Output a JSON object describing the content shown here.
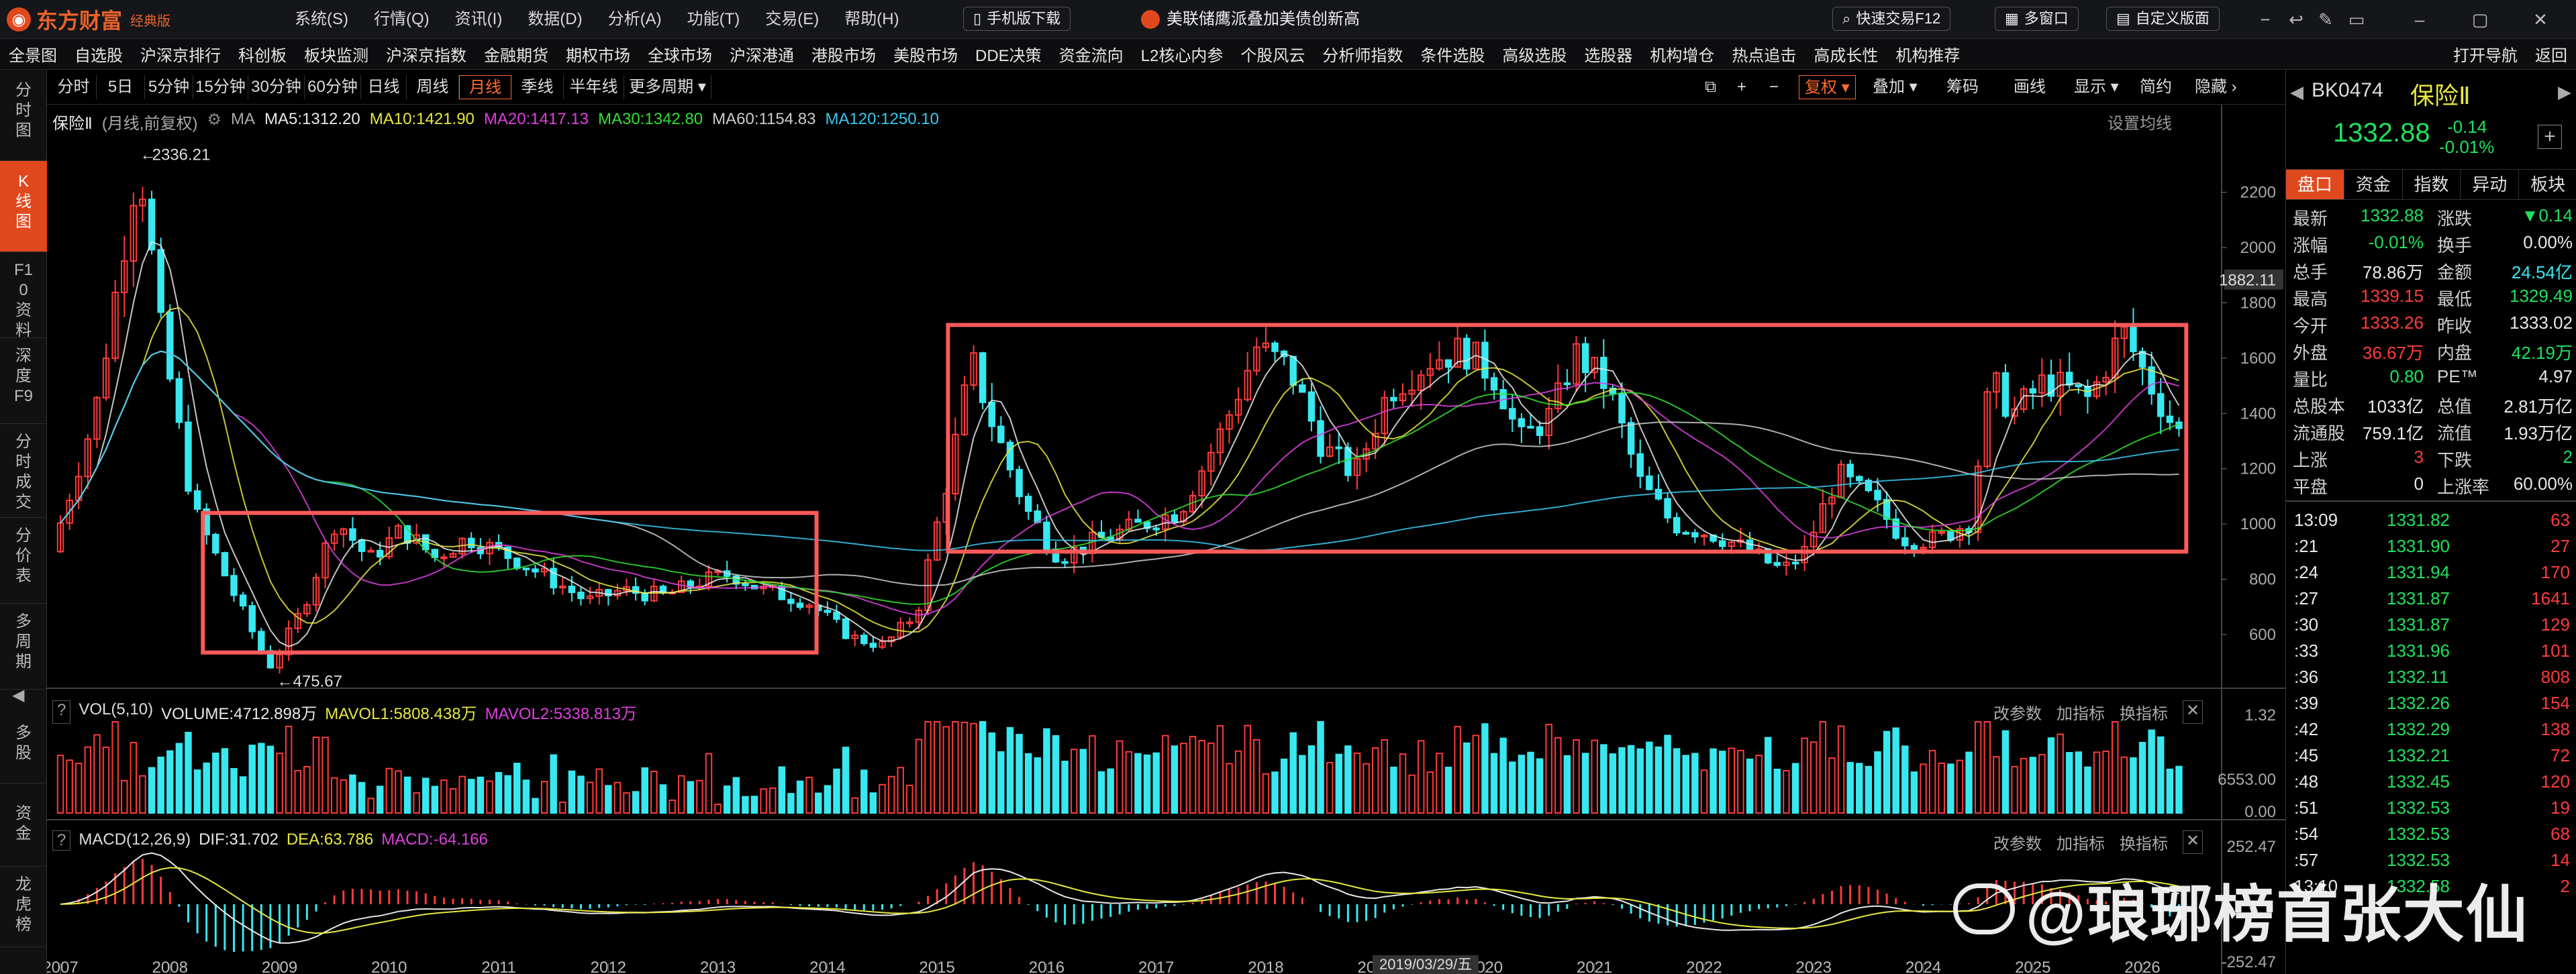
{
  "app": {
    "brand": "东方财富",
    "edition": "经典版",
    "menu": [
      "系统(S)",
      "行情(Q)",
      "资讯(I)",
      "数据(D)",
      "分析(A)",
      "功能(T)",
      "交易(E)",
      "帮助(H)"
    ],
    "mobile_download": "手机版下载",
    "news": "美联储鹰派叠加美债创新高",
    "quick_trade": "快速交易F12",
    "multi_window": "多窗口",
    "custom_layout": "自定义版面"
  },
  "navbar": [
    "全景图",
    "自选股",
    "沪深京排行",
    "科创板",
    "板块监测",
    "沪深京指数",
    "金融期货",
    "期权市场",
    "全球市场",
    "沪深港通",
    "港股市场",
    "美股市场",
    "DDE决策",
    "资金流向",
    "L2核心内参",
    "个股风云",
    "分析师指数",
    "条件选股",
    "高级选股",
    "选股器",
    "机构增仓",
    "热点追击",
    "高成长性",
    "机构推荐",
    "打开导航",
    "返回"
  ],
  "leftbar": [
    "分时图",
    "K线图",
    "F10资料",
    "深度F9",
    "分时成交",
    "分价表",
    "多周期",
    "多股",
    "资金",
    "龙虎榜"
  ],
  "toolbar": {
    "periods": [
      "分时",
      "5日",
      "5分钟",
      "15分钟",
      "30分钟",
      "60分钟",
      "日线",
      "周线",
      "月线",
      "季线",
      "半年线",
      "更多周期"
    ],
    "active_period": "月线",
    "right": [
      "复权",
      "叠加",
      "筹码",
      "画线",
      "显示",
      "简约",
      "隐藏"
    ]
  },
  "chart_legend": {
    "name": "保险Ⅱ",
    "mode": "(月线,前复权)",
    "ma_label": "MA",
    "ma5": "MA5:1312.20",
    "ma10": "MA10:1421.90",
    "ma20": "MA20:1417.13",
    "ma30": "MA30:1342.80",
    "ma60": "MA60:1154.83",
    "ma120": "MA120:1250.10",
    "set_ma": "设置均线"
  },
  "volume_legend": {
    "label": "VOL(5,10)",
    "volume": "VOLUME:4712.898万",
    "mavol1": "MAVOL1:5808.438万",
    "mavol2": "MAVOL2:5338.813万",
    "actions": [
      "改参数",
      "加指标",
      "换指标"
    ]
  },
  "macd_legend": {
    "label": "MACD(12,26,9)",
    "dif": "DIF:31.702",
    "dea": "DEA:63.786",
    "macd": "MACD:-64.166",
    "actions": [
      "改参数",
      "加指标",
      "换指标"
    ]
  },
  "cursor_date": "2019/03/29/五",
  "chart_data": {
    "type": "candlestick",
    "title": "保险Ⅱ (月线,前复权)",
    "price_axis": {
      "ticks": [
        600,
        800,
        1000,
        1200,
        1400,
        1600,
        1800,
        2000,
        2200
      ],
      "current_label": "1882.11",
      "ylim": [
        430,
        2420
      ]
    },
    "volume_axis": {
      "ticks": [
        "1.32",
        "6553.00",
        "0.00"
      ]
    },
    "macd_axis": {
      "ticks": [
        "252.47",
        "-252.47"
      ]
    },
    "x_axis_years": [
      "2007",
      "2008",
      "2009",
      "2010",
      "2011",
      "2012",
      "2013",
      "2014",
      "2015",
      "2016",
      "2017",
      "2018",
      "2019",
      "2020",
      "2021",
      "2022",
      "2023",
      "2024",
      "2025",
      "2026"
    ],
    "annotations": {
      "high_label": "2336.21",
      "low_label": "475.67"
    },
    "price_path": [
      [
        2007.0,
        900
      ],
      [
        2007.4,
        1400
      ],
      [
        2007.8,
        2336
      ],
      [
        2008.0,
        1700
      ],
      [
        2008.3,
        1050
      ],
      [
        2008.7,
        720
      ],
      [
        2009.0,
        475
      ],
      [
        2009.3,
        700
      ],
      [
        2009.6,
        1020
      ],
      [
        2009.9,
        870
      ],
      [
        2010.2,
        980
      ],
      [
        2010.5,
        880
      ],
      [
        2010.8,
        950
      ],
      [
        2011.2,
        880
      ],
      [
        2011.6,
        790
      ],
      [
        2011.9,
        720
      ],
      [
        2012.2,
        760
      ],
      [
        2012.6,
        740
      ],
      [
        2012.9,
        790
      ],
      [
        2013.2,
        820
      ],
      [
        2013.5,
        760
      ],
      [
        2013.9,
        720
      ],
      [
        2014.3,
        590
      ],
      [
        2014.6,
        560
      ],
      [
        2014.9,
        680
      ],
      [
        2015.2,
        1200
      ],
      [
        2015.4,
        1590
      ],
      [
        2015.6,
        1350
      ],
      [
        2015.9,
        1050
      ],
      [
        2016.2,
        880
      ],
      [
        2016.6,
        950
      ],
      [
        2016.9,
        990
      ],
      [
        2017.3,
        1050
      ],
      [
        2017.7,
        1350
      ],
      [
        2018.0,
        1640
      ],
      [
        2018.3,
        1560
      ],
      [
        2018.6,
        1280
      ],
      [
        2018.9,
        1180
      ],
      [
        2019.2,
        1480
      ],
      [
        2019.6,
        1600
      ],
      [
        2019.9,
        1630
      ],
      [
        2020.2,
        1520
      ],
      [
        2020.4,
        1300
      ],
      [
        2020.7,
        1400
      ],
      [
        2020.9,
        1620
      ],
      [
        2021.2,
        1500
      ],
      [
        2021.5,
        1150
      ],
      [
        2021.8,
        1000
      ],
      [
        2022.2,
        960
      ],
      [
        2022.5,
        900
      ],
      [
        2022.8,
        830
      ],
      [
        2023.0,
        900
      ],
      [
        2023.3,
        1180
      ],
      [
        2023.6,
        1090
      ],
      [
        2023.9,
        950
      ],
      [
        2024.2,
        940
      ],
      [
        2024.5,
        1010
      ],
      [
        2024.7,
        1520
      ],
      [
        2024.9,
        1400
      ],
      [
        2025.2,
        1520
      ],
      [
        2025.6,
        1450
      ],
      [
        2025.9,
        1700
      ],
      [
        2026.2,
        1470
      ],
      [
        2026.4,
        1333
      ]
    ],
    "boxes": [
      {
        "x0": 2008.3,
        "x1": 2013.9,
        "y0": 535,
        "y1": 1040
      },
      {
        "x0": 2015.1,
        "x1": 2026.4,
        "y0": 900,
        "y1": 1720
      }
    ]
  },
  "quote": {
    "code": "BK0474",
    "name": "保险Ⅱ",
    "price": "1332.88",
    "change": "-0.14",
    "change_pct": "-0.01%",
    "tabs": [
      "盘口",
      "资金",
      "指数",
      "异动",
      "板块"
    ],
    "rows": [
      {
        "l1": "最新",
        "v1": "1332.88",
        "c1": "green",
        "l2": "涨跌",
        "v2": "▼0.14",
        "c2": "green"
      },
      {
        "l1": "涨幅",
        "v1": "-0.01%",
        "c1": "green",
        "l2": "换手",
        "v2": "0.00%",
        "c2": "white"
      },
      {
        "l1": "总手",
        "v1": "78.86万",
        "c1": "white",
        "l2": "金额",
        "v2": "24.54亿",
        "c2": "cyan"
      },
      {
        "l1": "最高",
        "v1": "1339.15",
        "c1": "red",
        "l2": "最低",
        "v2": "1329.49",
        "c2": "green"
      },
      {
        "l1": "今开",
        "v1": "1333.26",
        "c1": "red",
        "l2": "昨收",
        "v2": "1333.02",
        "c2": "white"
      },
      {
        "l1": "外盘",
        "v1": "36.67万",
        "c1": "red",
        "l2": "内盘",
        "v2": "42.19万",
        "c2": "green"
      },
      {
        "l1": "量比",
        "v1": "0.80",
        "c1": "green",
        "l2": "PE™",
        "v2": "4.97",
        "c2": "white"
      },
      {
        "l1": "总股本",
        "v1": "1033亿",
        "c1": "white",
        "l2": "总值",
        "v2": "2.81万亿",
        "c2": "white"
      },
      {
        "l1": "流通股",
        "v1": "759.1亿",
        "c1": "white",
        "l2": "流值",
        "v2": "1.93万亿",
        "c2": "white"
      },
      {
        "l1": "上涨",
        "v1": "3",
        "c1": "red",
        "l2": "下跌",
        "v2": "2",
        "c2": "green"
      },
      {
        "l1": "平盘",
        "v1": "0",
        "c1": "white",
        "l2": "上涨率",
        "v2": "60.00%",
        "c2": "white"
      }
    ],
    "ticks": [
      {
        "t": "13:09",
        "p": "1331.82",
        "v": "63"
      },
      {
        "t": ":21",
        "p": "1331.90",
        "v": "27"
      },
      {
        "t": ":24",
        "p": "1331.94",
        "v": "170"
      },
      {
        "t": ":27",
        "p": "1331.87",
        "v": "1641"
      },
      {
        "t": ":30",
        "p": "1331.87",
        "v": "129"
      },
      {
        "t": ":33",
        "p": "1331.96",
        "v": "101"
      },
      {
        "t": ":36",
        "p": "1332.11",
        "v": "808"
      },
      {
        "t": ":39",
        "p": "1332.26",
        "v": "154"
      },
      {
        "t": ":42",
        "p": "1332.29",
        "v": "138"
      },
      {
        "t": ":45",
        "p": "1332.21",
        "v": "72"
      },
      {
        "t": ":48",
        "p": "1332.45",
        "v": "120"
      },
      {
        "t": ":51",
        "p": "1332.53",
        "v": "19"
      },
      {
        "t": ":54",
        "p": "1332.53",
        "v": "68"
      },
      {
        "t": ":57",
        "p": "1332.53",
        "v": "14"
      },
      {
        "t": "13:10",
        "p": "1332.58",
        "v": "2"
      }
    ]
  },
  "watermark": "@琅琊榜首张大仙",
  "colors": {
    "up": "#ff3b3b",
    "down": "#38e8f0",
    "box": "#ff5a5a",
    "accent": "#ff6a2c"
  }
}
